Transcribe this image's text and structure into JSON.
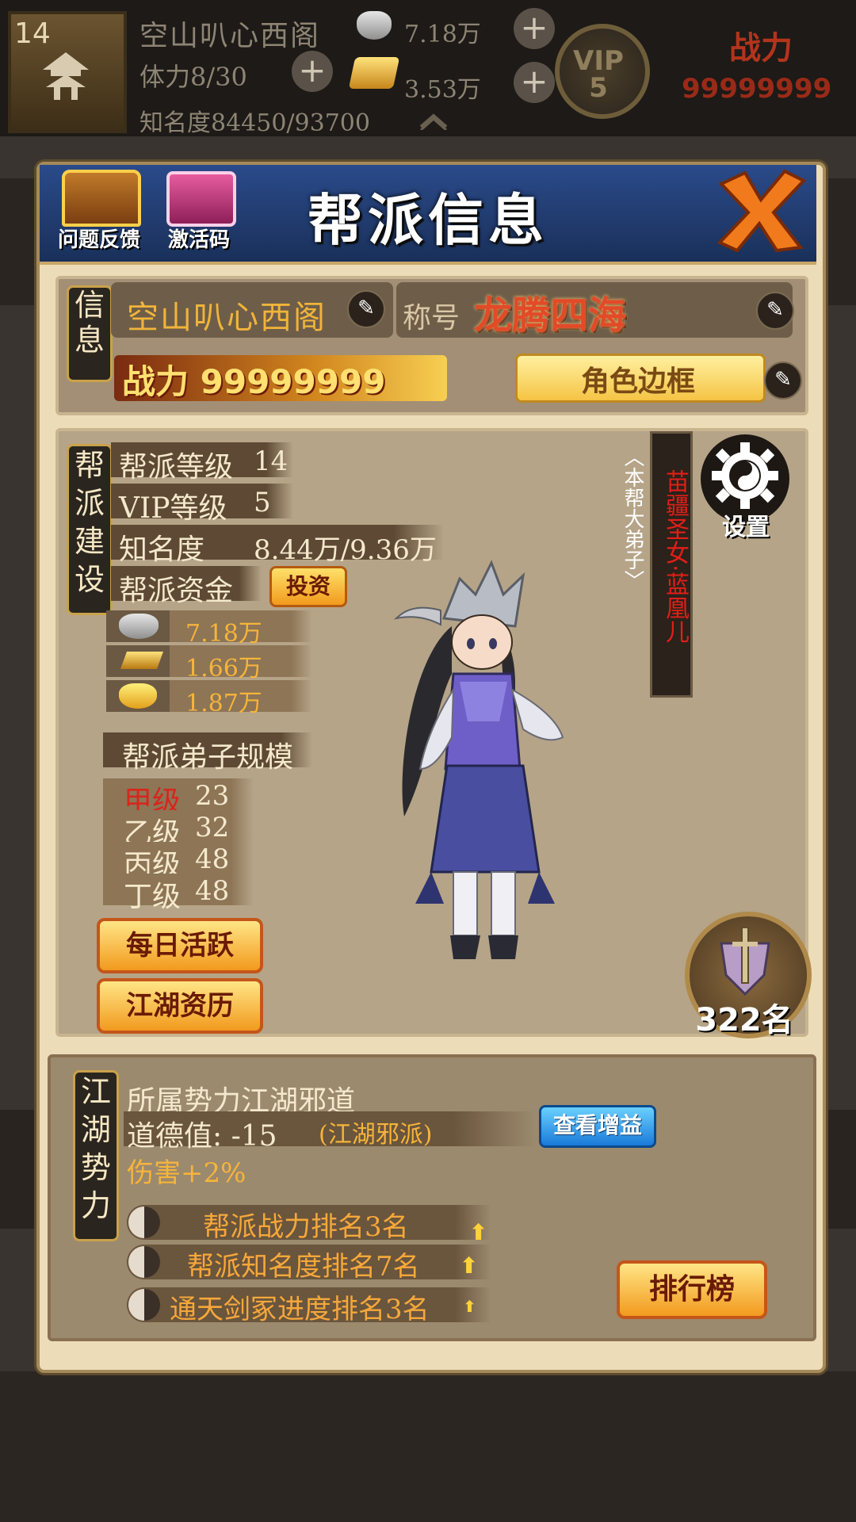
{
  "topbar": {
    "level": "14",
    "player_name": "空山叭心西阁",
    "stamina": "体力8/30",
    "fame": "知名度84450/93700",
    "silver": "7.18万",
    "gold": "3.53万",
    "vip_label": "VIP",
    "vip_level": "5",
    "power_label": "战力",
    "power_value": "99999999"
  },
  "panel": {
    "title": "帮派信息",
    "feedback_label": "问题反馈",
    "activation_label": "激活码",
    "info_tag": "信息",
    "name": "空山叭心西阁",
    "title_prefix": "称号",
    "title_value": "龙腾四海",
    "power_label": "战力",
    "power_value": "99999999",
    "frame_label": "角色边框"
  },
  "build": {
    "tag": "帮派建设",
    "rows": [
      {
        "label": "帮派等级",
        "value": "14"
      },
      {
        "label": "VIP等级",
        "value": "5"
      },
      {
        "label": "知名度",
        "value": "8.44万/9.36万"
      }
    ],
    "fund_label": "帮派资金",
    "invest_label": "投资",
    "funds": [
      {
        "icon": "silver-ingot-icon",
        "value": "7.18万"
      },
      {
        "icon": "gold-bar-icon",
        "value": "1.66万"
      },
      {
        "icon": "gold-ingot-icon",
        "value": "1.87万"
      }
    ],
    "disciple_label": "帮派弟子规模",
    "grades": [
      {
        "label": "甲级",
        "value": "23",
        "color": "#d8261c"
      },
      {
        "label": "乙级",
        "value": "32",
        "color": "#f5e9cd"
      },
      {
        "label": "丙级",
        "value": "48",
        "color": "#f5e9cd"
      },
      {
        "label": "丁级",
        "value": "48",
        "color": "#f5e9cd"
      }
    ],
    "daily_btn": "每日活跃",
    "history_btn": "江湖资历",
    "character_name": "苗疆圣女·蓝凰儿",
    "character_sub": "〈本帮大弟子〉",
    "settings_label": "设置",
    "rank_value": "322名"
  },
  "jianghu": {
    "tag": "江湖势力",
    "faction": "所属势力江湖邪道",
    "morality": "道德值: -15",
    "morality_note": "(江湖邪派)",
    "bonus_btn": "查看增益",
    "damage": "伤害+2%",
    "ranks": [
      "帮派战力排名3名",
      "帮派知名度排名7名",
      "通天剑冢进度排名3名"
    ],
    "leaderboard_btn": "排行榜"
  },
  "colors": {
    "accent_gold": "#f6b43a",
    "header_blue": "#1f3868",
    "button_orange": "#f29a1e",
    "button_blue": "#1a7ad8",
    "red_text": "#d8261c"
  }
}
